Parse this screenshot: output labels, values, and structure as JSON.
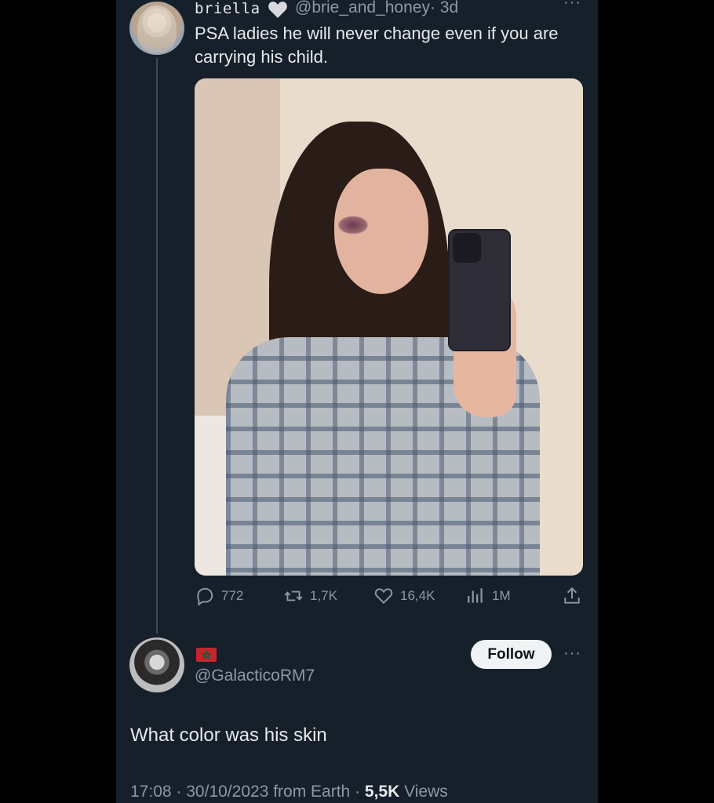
{
  "tweet": {
    "author_name": "briella",
    "author_handle": "@brie_and_honey",
    "time_ago": "· 3d",
    "text": "PSA ladies he will never change even if you are carrying his child.",
    "more_label": "···",
    "stats": {
      "replies": "772",
      "retweets": "1,7K",
      "likes": "16,4K",
      "views": "1M"
    }
  },
  "reply": {
    "author_handle": "@GalacticoRM7",
    "follow_label": "Follow",
    "more_label": "···",
    "text": "What color was his skin",
    "time": "17:08",
    "date": "30/10/2023",
    "source": "from Earth",
    "views_count": "5,5K",
    "views_label": "Views"
  },
  "colors": {
    "background": "#15202b",
    "text": "#e7e9ea",
    "muted": "#8b98a5"
  },
  "icons": [
    "heart-emoji-icon",
    "more-icon",
    "reply-icon",
    "retweet-icon",
    "like-icon",
    "views-icon",
    "share-icon",
    "morocco-flag-icon"
  ]
}
